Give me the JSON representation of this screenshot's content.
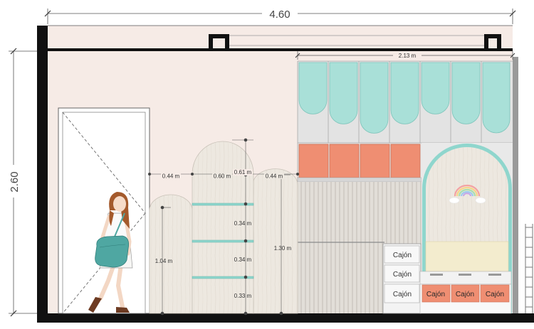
{
  "dimensions": {
    "total_width": "4.60",
    "total_height": "2.60",
    "shop_width": "2.13 m",
    "panel_a_width": "0.44 m",
    "panel_b_width": "0.60 m",
    "panel_c_width": "0.44 m",
    "panel_b_top": "0.61 m",
    "panel_a_height": "1.04 m",
    "panel_c_height": "1.30 m",
    "shelf_gap_1": "0.34 m",
    "shelf_gap_2": "0.34 m",
    "shelf_gap_3": "0.33 m"
  },
  "drawers": {
    "label_1": "Cajón",
    "label_2": "Cajón",
    "label_3": "Cajón",
    "bench_1": "Cajón",
    "bench_2": "Cajón",
    "bench_3": "Cajón"
  },
  "colors": {
    "wall": "#f6ebe6",
    "awning": "#a9e0d8",
    "coral": "#ef8e72",
    "wood": "#ece7df",
    "slats": "#dcd8d2",
    "arch_frame": "#8fd6cd"
  }
}
